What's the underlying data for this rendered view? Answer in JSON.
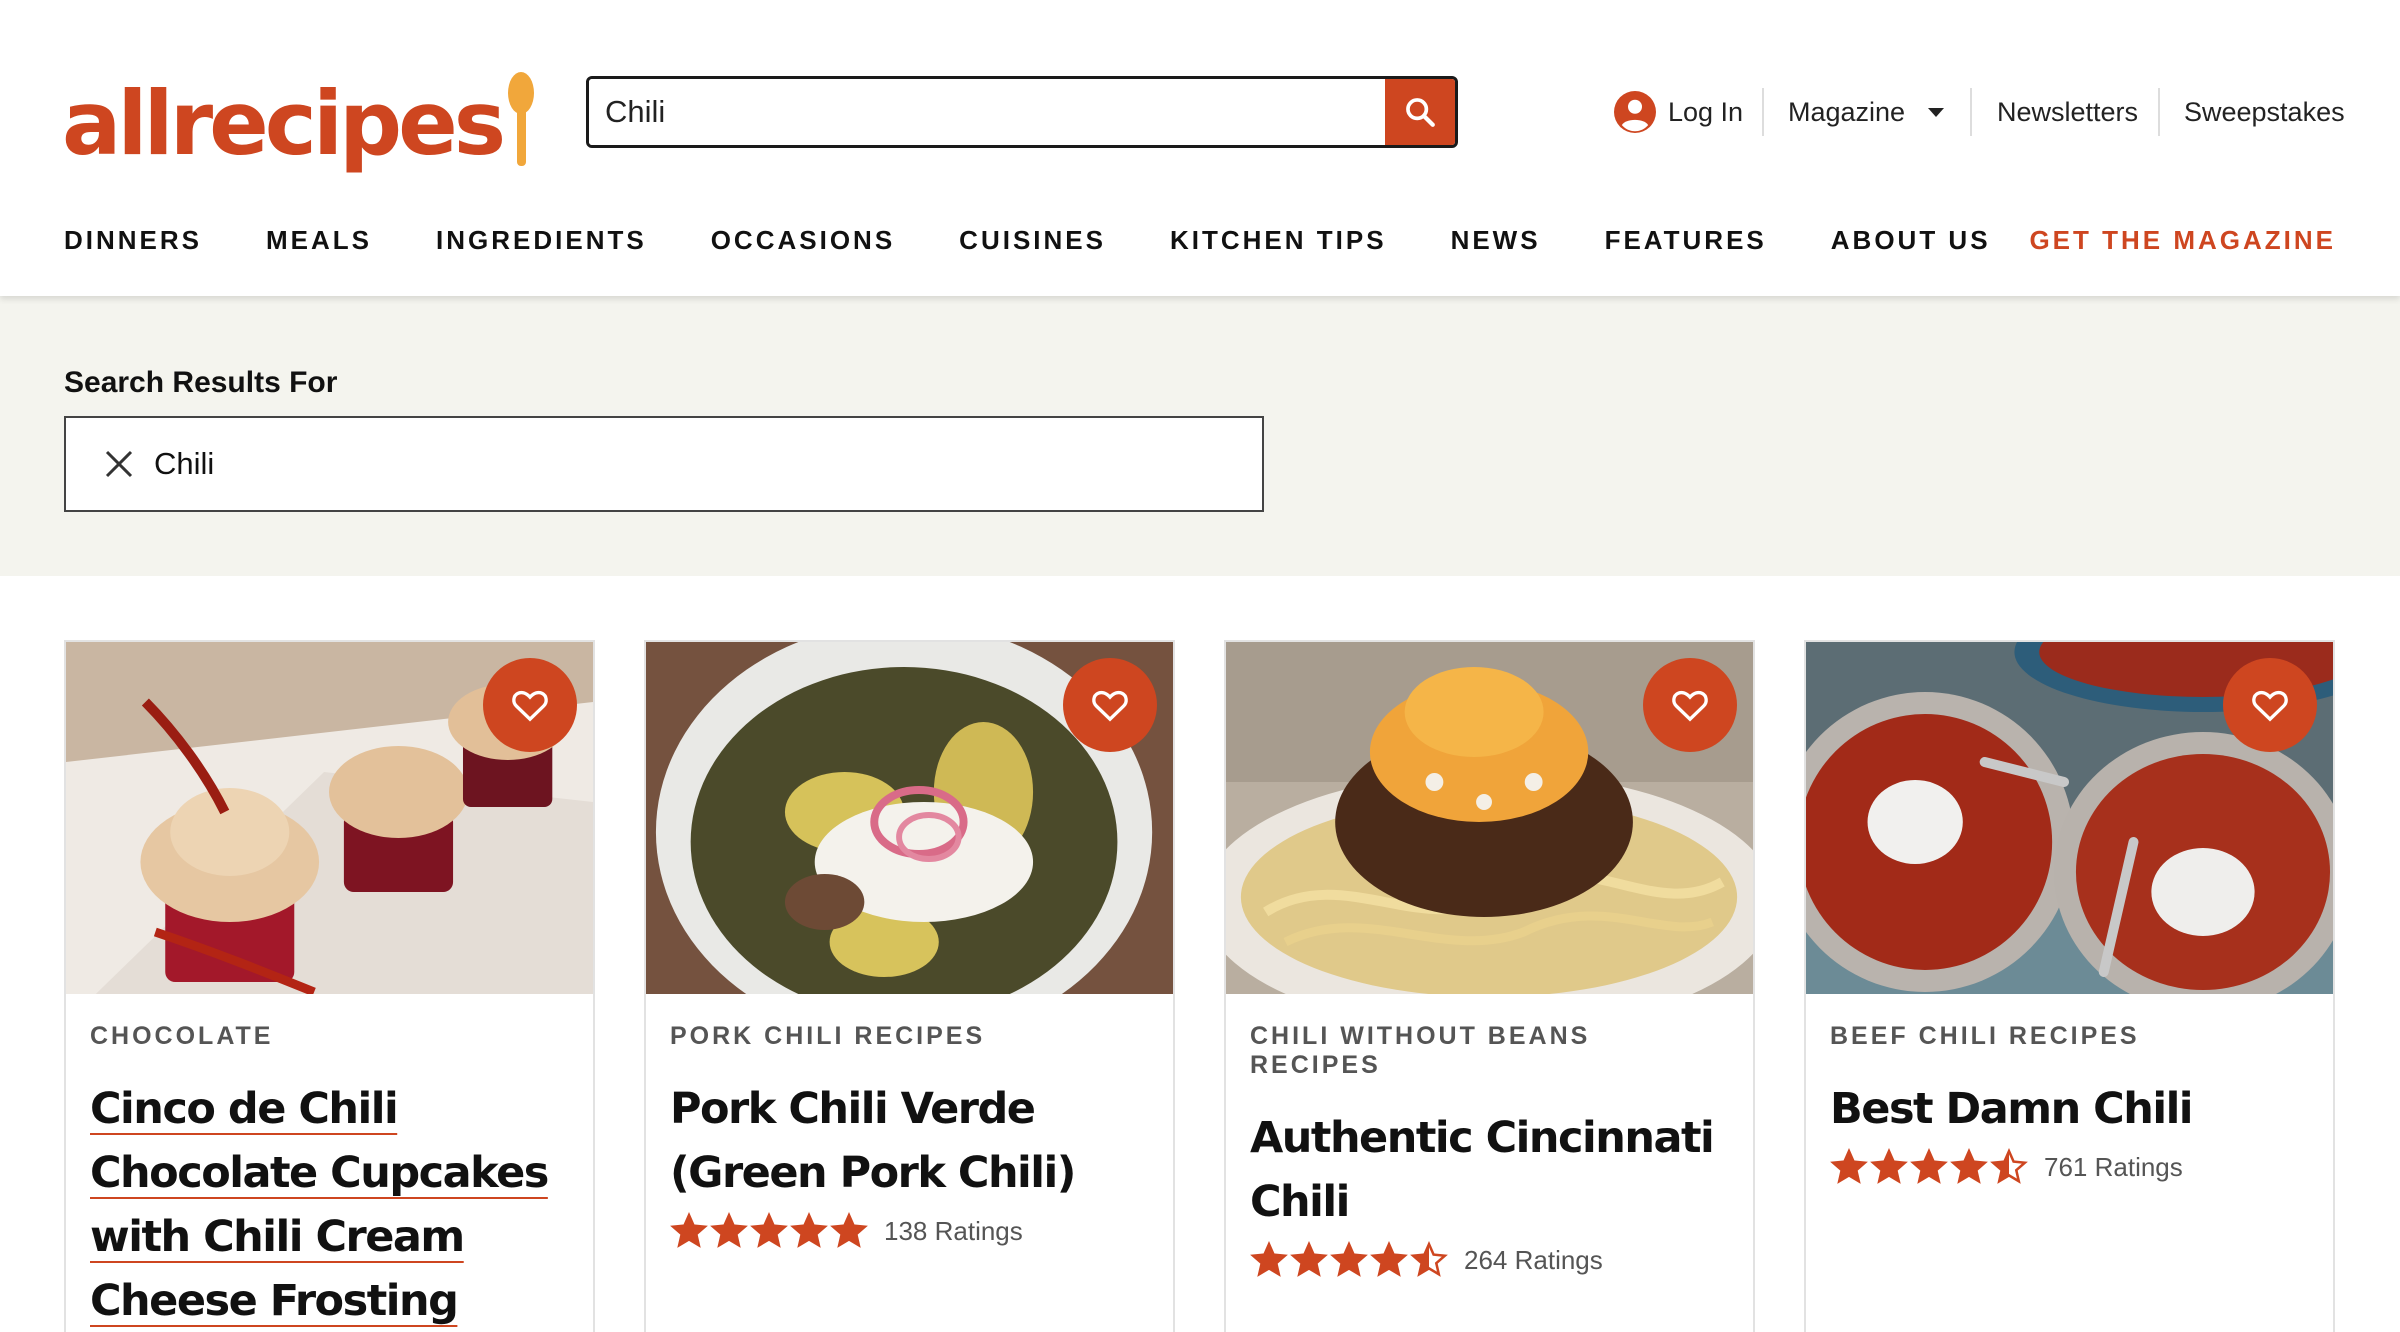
{
  "logo": {
    "text": "allrecipes"
  },
  "header_search": {
    "value": "Chili",
    "icon": "search-icon"
  },
  "utility": {
    "login": "Log In",
    "magazine": "Magazine",
    "newsletters": "Newsletters",
    "sweepstakes": "Sweepstakes"
  },
  "nav": {
    "items": [
      "DINNERS",
      "MEALS",
      "INGREDIENTS",
      "OCCASIONS",
      "CUISINES",
      "KITCHEN TIPS",
      "NEWS",
      "FEATURES",
      "ABOUT US"
    ],
    "cta": "GET THE MAGAZINE"
  },
  "results": {
    "heading": "Search Results For",
    "query": "Chili"
  },
  "colors": {
    "brand": "#ce4620",
    "spoon": "#f1a73b",
    "band": "#f4f4ee"
  },
  "cards": [
    {
      "tag": "CHOCOLATE",
      "title_lines": [
        "Cinco de Chili",
        "Chocolate Cupcakes",
        "with Chili Cream",
        "Cheese Frosting"
      ],
      "stars": null,
      "ratings": null
    },
    {
      "tag": "PORK CHILI RECIPES",
      "title_lines": [
        "Pork Chili Verde",
        "(Green Pork Chili)"
      ],
      "stars": 5,
      "ratings": "138 Ratings"
    },
    {
      "tag": "CHILI WITHOUT BEANS RECIPES",
      "title_lines": [
        "Authentic Cincinnati",
        "Chili"
      ],
      "stars": 4.5,
      "ratings": "264 Ratings"
    },
    {
      "tag": "BEEF CHILI RECIPES",
      "title_lines": [
        "Best Damn Chili"
      ],
      "stars": 4.5,
      "ratings": "761 Ratings"
    }
  ]
}
